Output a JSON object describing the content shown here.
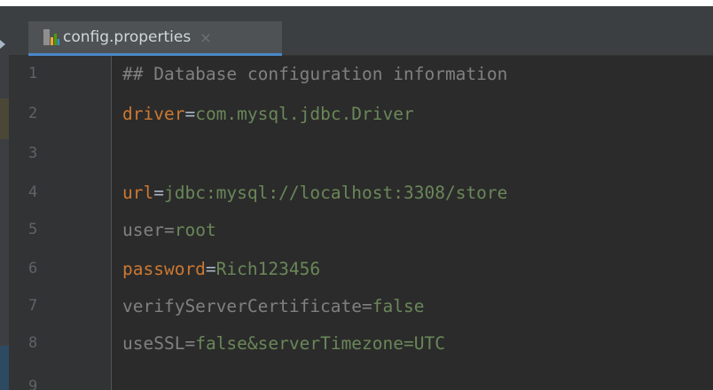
{
  "tab": {
    "filename": "config.properties",
    "close_glyph": "×",
    "icon": "properties-file-icon"
  },
  "lines": [
    {
      "number": "1",
      "comment": "## Database configuration information"
    },
    {
      "number": "2",
      "key": "driver",
      "eq": "=",
      "value": "com.mysql.jdbc.Driver"
    },
    {
      "number": "3"
    },
    {
      "number": "4",
      "key": "url",
      "eq": "=",
      "value": "jdbc:mysql://localhost:3308/store"
    },
    {
      "number": "5",
      "key": "user",
      "eq": "=",
      "value": "root"
    },
    {
      "number": "6",
      "key": "password",
      "eq": "=",
      "value": "Rich123456"
    },
    {
      "number": "7",
      "key": "verifyServerCertificate",
      "eq": "=",
      "value": "false"
    },
    {
      "number": "8",
      "key": "useSSL",
      "eq": "=",
      "value": "false&serverTimezone=UTC"
    },
    {
      "number": "9"
    }
  ],
  "colors": {
    "background": "#2b2b2b",
    "comment": "#808080",
    "key_highlight": "#cc7832",
    "value": "#6a8759",
    "line_number": "#606366",
    "tab_underline": "#4a88c7"
  }
}
